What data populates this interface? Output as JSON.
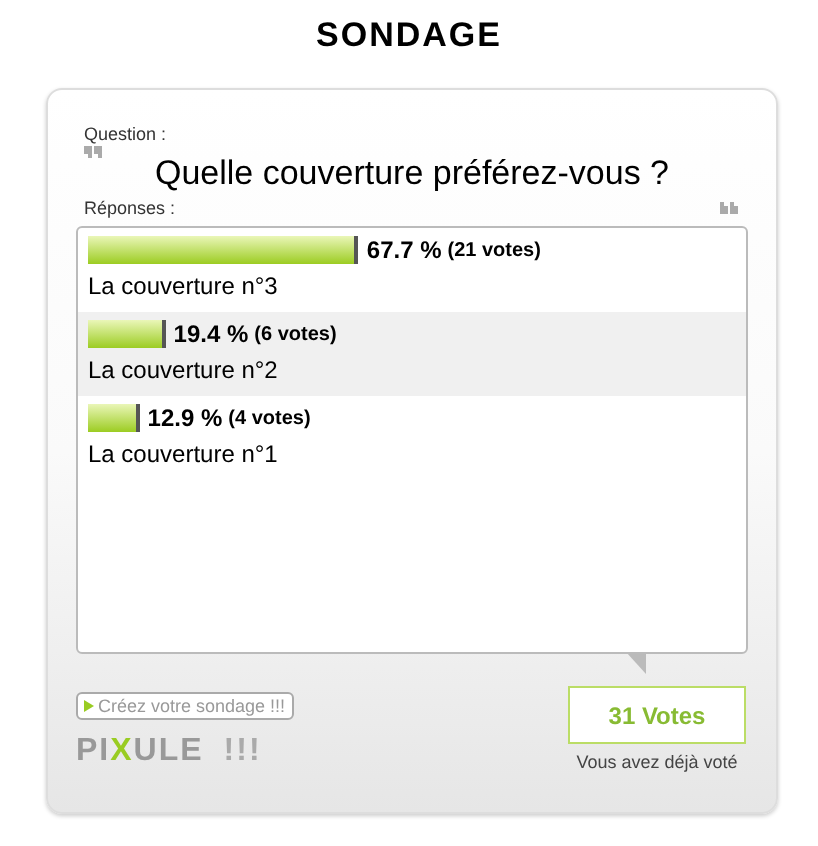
{
  "title": "SONDAGE",
  "question_label": "Question :",
  "question": "Quelle couverture préférez-vous ?",
  "answers_label": "Réponses :",
  "results": [
    {
      "percent": "67.7 %",
      "votes": "(21 votes)",
      "label": "La couverture n°3"
    },
    {
      "percent": "19.4 %",
      "votes": "(6 votes)",
      "label": "La couverture n°2"
    },
    {
      "percent": "12.9 %",
      "votes": "(4 votes)",
      "label": "La couverture n°1"
    }
  ],
  "create_link": "Créez votre sondage !!!",
  "logo": [
    {
      "text": "PI",
      "highlight": false
    },
    {
      "text": "X",
      "highlight": true
    },
    {
      "text": "ULE",
      "highlight": false
    }
  ],
  "logo_suffix": "!!!",
  "total_votes": "31 Votes",
  "status": "Vous avez déjà voté"
}
